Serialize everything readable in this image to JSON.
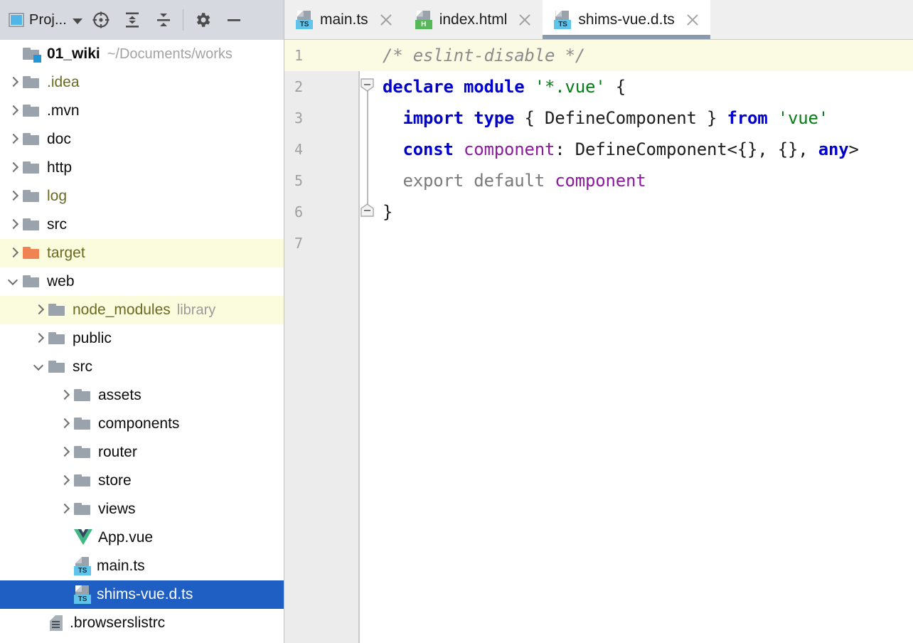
{
  "toolbar": {
    "project_label": "Proj...",
    "icons": [
      {
        "name": "select-opened-file-icon",
        "title": "Select Opened File"
      },
      {
        "name": "expand-all-icon",
        "title": "Expand All"
      },
      {
        "name": "collapse-all-icon",
        "title": "Collapse All"
      },
      {
        "name": "settings-gear-icon",
        "title": "Settings"
      },
      {
        "name": "hide-icon",
        "title": "Hide"
      }
    ]
  },
  "tabs": [
    {
      "label": "main.ts",
      "icon": "typescript-file-icon",
      "badge": "TS",
      "badge_kind": "ts",
      "active": false
    },
    {
      "label": "index.html",
      "icon": "html-file-icon",
      "badge": "H",
      "badge_kind": "html",
      "active": false
    },
    {
      "label": "shims-vue.d.ts",
      "icon": "typescript-file-icon",
      "badge": "TS",
      "badge_kind": "ts",
      "active": true
    }
  ],
  "tree": {
    "root": {
      "name": "01_wiki",
      "path": "~/Documents/works"
    },
    "items": [
      {
        "label": ".idea",
        "depth": 1,
        "arrow": "closed",
        "icon": "folder",
        "style": "olive"
      },
      {
        "label": ".mvn",
        "depth": 1,
        "arrow": "closed",
        "icon": "folder",
        "style": "normal"
      },
      {
        "label": "doc",
        "depth": 1,
        "arrow": "closed",
        "icon": "folder",
        "style": "normal"
      },
      {
        "label": "http",
        "depth": 1,
        "arrow": "closed",
        "icon": "folder",
        "style": "normal"
      },
      {
        "label": "log",
        "depth": 1,
        "arrow": "closed",
        "icon": "folder",
        "style": "olive"
      },
      {
        "label": "src",
        "depth": 1,
        "arrow": "closed",
        "icon": "folder",
        "style": "normal"
      },
      {
        "label": "target",
        "depth": 1,
        "arrow": "closed",
        "icon": "folder-orange",
        "style": "olive",
        "row": "highlight"
      },
      {
        "label": "web",
        "depth": 1,
        "arrow": "open",
        "icon": "folder",
        "style": "normal"
      },
      {
        "label": "node_modules",
        "depth": 2,
        "arrow": "closed",
        "icon": "folder",
        "style": "olive",
        "suffix": "library",
        "row": "highlight"
      },
      {
        "label": "public",
        "depth": 2,
        "arrow": "closed",
        "icon": "folder",
        "style": "normal"
      },
      {
        "label": "src",
        "depth": 2,
        "arrow": "open",
        "icon": "folder",
        "style": "normal"
      },
      {
        "label": "assets",
        "depth": 3,
        "arrow": "closed",
        "icon": "folder",
        "style": "normal"
      },
      {
        "label": "components",
        "depth": 3,
        "arrow": "closed",
        "icon": "folder",
        "style": "normal"
      },
      {
        "label": "router",
        "depth": 3,
        "arrow": "closed",
        "icon": "folder",
        "style": "normal"
      },
      {
        "label": "store",
        "depth": 3,
        "arrow": "closed",
        "icon": "folder",
        "style": "normal"
      },
      {
        "label": "views",
        "depth": 3,
        "arrow": "closed",
        "icon": "folder",
        "style": "normal"
      },
      {
        "label": "App.vue",
        "depth": 3,
        "arrow": "none",
        "icon": "vue",
        "style": "normal"
      },
      {
        "label": "main.ts",
        "depth": 3,
        "arrow": "none",
        "icon": "ts",
        "style": "normal"
      },
      {
        "label": "shims-vue.d.ts",
        "depth": 3,
        "arrow": "none",
        "icon": "ts",
        "style": "normal",
        "row": "selected"
      },
      {
        "label": ".browserslistrc",
        "depth": 2,
        "arrow": "none",
        "icon": "text",
        "style": "normal"
      }
    ]
  },
  "editor": {
    "active_file": "shims-vue.d.ts",
    "line_numbers": [
      "1",
      "2",
      "3",
      "4",
      "5",
      "6",
      "7"
    ],
    "current_line": 1,
    "fold_markers": [
      {
        "line": 2,
        "state": "expanded"
      },
      {
        "line": 6,
        "state": "end"
      }
    ],
    "lines": [
      {
        "n": "1",
        "tokens": [
          {
            "t": "/* eslint-disable */",
            "c": "cmt"
          }
        ]
      },
      {
        "n": "2",
        "tokens": [
          {
            "t": "declare",
            "c": "kw"
          },
          {
            "t": " ",
            "c": "pln"
          },
          {
            "t": "module",
            "c": "kw"
          },
          {
            "t": " ",
            "c": "pln"
          },
          {
            "t": "'*.vue'",
            "c": "str"
          },
          {
            "t": " {",
            "c": "pln"
          }
        ]
      },
      {
        "n": "3",
        "tokens": [
          {
            "t": "  ",
            "c": "pln"
          },
          {
            "t": "import",
            "c": "kw"
          },
          {
            "t": " ",
            "c": "pln"
          },
          {
            "t": "type",
            "c": "kw"
          },
          {
            "t": " { ",
            "c": "pln"
          },
          {
            "t": "DefineComponent",
            "c": "ident"
          },
          {
            "t": " } ",
            "c": "pln"
          },
          {
            "t": "from",
            "c": "kw"
          },
          {
            "t": " ",
            "c": "pln"
          },
          {
            "t": "'vue'",
            "c": "str"
          }
        ]
      },
      {
        "n": "4",
        "tokens": [
          {
            "t": "  ",
            "c": "pln"
          },
          {
            "t": "const",
            "c": "kw"
          },
          {
            "t": " ",
            "c": "pln"
          },
          {
            "t": "component",
            "c": "fld"
          },
          {
            "t": ": ",
            "c": "pln"
          },
          {
            "t": "DefineComponent",
            "c": "ident"
          },
          {
            "t": "<{}, {}, ",
            "c": "pln"
          },
          {
            "t": "any",
            "c": "kw"
          },
          {
            "t": ">",
            "c": "pln"
          }
        ]
      },
      {
        "n": "5",
        "tokens": [
          {
            "t": "  ",
            "c": "pln"
          },
          {
            "t": "export default ",
            "c": "dim"
          },
          {
            "t": "component",
            "c": "fld"
          }
        ]
      },
      {
        "n": "6",
        "tokens": [
          {
            "t": "}",
            "c": "pln"
          }
        ]
      },
      {
        "n": "7",
        "tokens": [
          {
            "t": "",
            "c": "pln"
          }
        ]
      }
    ]
  },
  "colors": {
    "selection_blue": "#1f5fc4",
    "highlight_yellow": "#fbfbdd",
    "current_line": "#fbfbe3",
    "excluded_olive": "#6a6a21",
    "ts_badge": "#5ec4ec",
    "html_badge": "#57b85a",
    "target_folder_orange": "#ef8354",
    "active_tab_underline": "#8b9bae",
    "keyword_blue": "#0000cf",
    "string_green": "#067d17",
    "field_purple": "#8c1a9e",
    "comment_gray": "#8c8c8c"
  }
}
